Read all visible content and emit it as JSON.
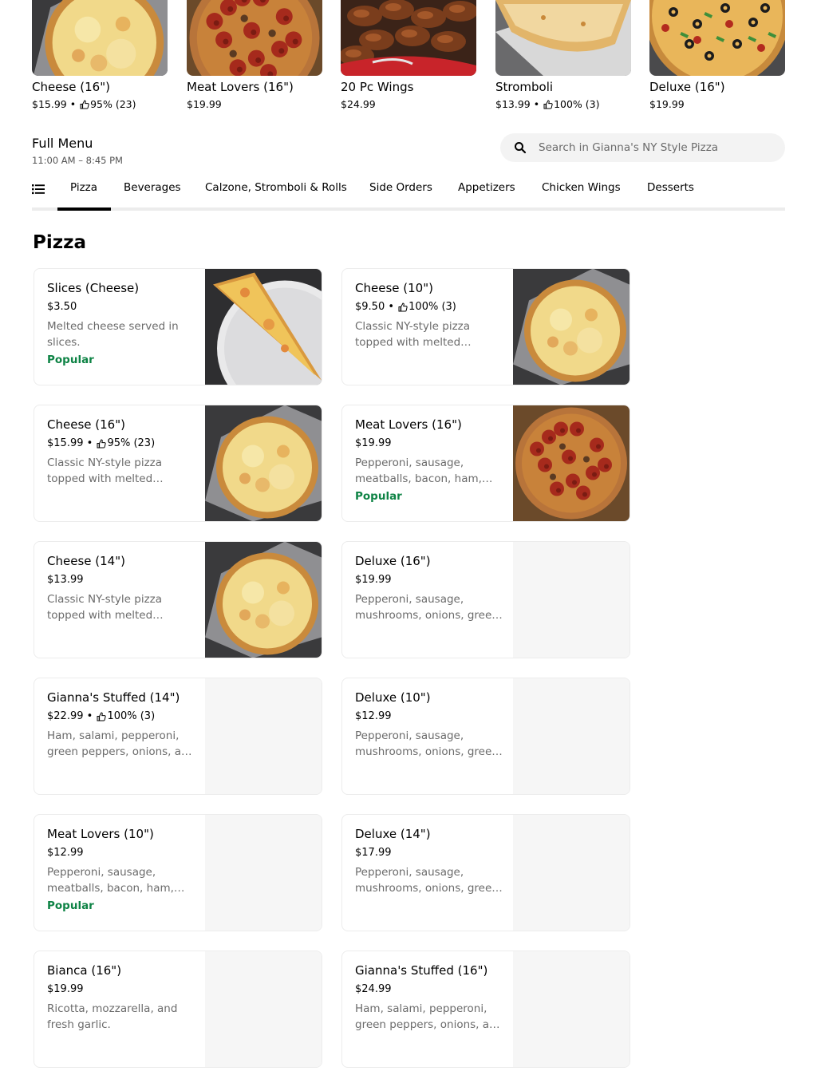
{
  "featured": [
    {
      "name": "Cheese (16\")",
      "price": "$15.99",
      "rating": "95% (23)",
      "image": "cheese-pizza"
    },
    {
      "name": "Meat Lovers (16\")",
      "price": "$19.99",
      "rating": "",
      "image": "meat-pizza"
    },
    {
      "name": "20 Pc Wings",
      "price": "$24.99",
      "rating": "",
      "image": "wings"
    },
    {
      "name": "Stromboli",
      "price": "$13.99",
      "rating": "100% (3)",
      "image": "stromboli"
    },
    {
      "name": "Deluxe (16\")",
      "price": "$19.99",
      "rating": "",
      "image": "deluxe-pizza"
    }
  ],
  "menu": {
    "title": "Full Menu",
    "hours": "11:00 AM – 8:45 PM",
    "search_placeholder": "Search in Gianna's NY Style Pizza"
  },
  "tabs": [
    "Pizza",
    "Beverages",
    "Calzone, Stromboli & Rolls",
    "Side Orders",
    "Appetizers",
    "Chicken Wings",
    "Desserts"
  ],
  "active_tab": "Pizza",
  "section": {
    "title": "Pizza"
  },
  "items": [
    {
      "name": "Slices (Cheese)",
      "price": "$3.50",
      "rating": "",
      "desc": "Melted cheese served in slices.",
      "badge": "Popular",
      "image": "slice"
    },
    {
      "name": "Cheese (10\")",
      "price": "$9.50",
      "rating": "100% (3)",
      "desc": "Classic NY-style pizza topped with melted cheese.",
      "badge": "",
      "image": "cheese-pizza"
    },
    {
      "name": "Cheese (16\")",
      "price": "$15.99",
      "rating": "95% (23)",
      "desc": "Classic NY-style pizza topped with melted cheese.",
      "badge": "",
      "image": "cheese-pizza"
    },
    {
      "name": "Meat Lovers (16\")",
      "price": "$19.99",
      "rating": "",
      "desc": "Pepperoni, sausage, meatballs, bacon, ham, and more.",
      "badge": "Popular",
      "image": "meat-pizza"
    },
    {
      "name": "Cheese (14\")",
      "price": "$13.99",
      "rating": "",
      "desc": "Classic NY-style pizza topped with melted cheese.",
      "badge": "",
      "image": "cheese-pizza"
    },
    {
      "name": "Deluxe (16\")",
      "price": "$19.99",
      "rating": "",
      "desc": "Pepperoni, sausage, mushrooms, onions, green peppers.",
      "badge": "",
      "image": ""
    },
    {
      "name": "Gianna's Stuffed (14\")",
      "price": "$22.99",
      "rating": "100% (3)",
      "desc": "Ham, salami, pepperoni, green peppers, onions, and more.",
      "badge": "",
      "image": ""
    },
    {
      "name": "Deluxe (10\")",
      "price": "$12.99",
      "rating": "",
      "desc": "Pepperoni, sausage, mushrooms, onions, green peppers.",
      "badge": "",
      "image": ""
    },
    {
      "name": "Meat Lovers (10\")",
      "price": "$12.99",
      "rating": "",
      "desc": "Pepperoni, sausage, meatballs, bacon, ham, and more.",
      "badge": "Popular",
      "image": ""
    },
    {
      "name": "Deluxe (14\")",
      "price": "$17.99",
      "rating": "",
      "desc": "Pepperoni, sausage, mushrooms, onions, green peppers.",
      "badge": "",
      "image": ""
    },
    {
      "name": "Bianca (16\")",
      "price": "$19.99",
      "rating": "",
      "desc": "Ricotta, mozzarella, and fresh garlic.",
      "badge": "",
      "image": ""
    },
    {
      "name": "Gianna's Stuffed (16\")",
      "price": "$24.99",
      "rating": "",
      "desc": "Ham, salami, pepperoni, green peppers, onions, and more.",
      "badge": "",
      "image": ""
    }
  ],
  "colors": {
    "popular": "#0e8345",
    "muted": "#6b6b6b",
    "accent": "#000000"
  }
}
